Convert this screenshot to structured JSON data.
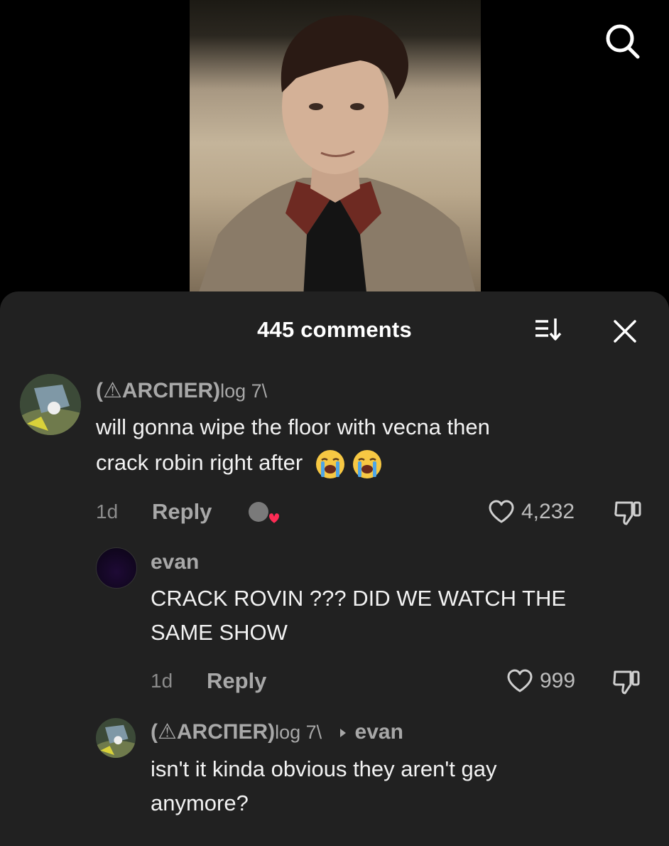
{
  "header": {
    "comment_count_title": "445 comments"
  },
  "comments": [
    {
      "username": "(⚠ARCПER)",
      "username_suffix": "log 7\\",
      "text_line1": "will gonna wipe the floor with vecna then",
      "text_line2": "crack robin right after",
      "emojis": [
        "loudly-crying-face",
        "loudly-crying-face"
      ],
      "time": "1d",
      "reply_label": "Reply",
      "likes": "4,232"
    },
    {
      "username": "evan",
      "text_line1": "CRACK ROVIN ??? DID WE WATCH THE",
      "text_line2": "SAME SHOW",
      "time": "1d",
      "reply_label": "Reply",
      "likes": "999"
    },
    {
      "username": "(⚠ARCПER)",
      "username_suffix": "log 7\\",
      "reply_to": "evan",
      "text_line1": "isn't it kinda obvious they aren't gay",
      "text_line2": "anymore?"
    }
  ],
  "colors": {
    "sheet_background": "#212121",
    "username": "#a8a8a8",
    "liked_heart": "#fe2c55"
  },
  "icons": {
    "top_right": "search-icon",
    "sort": "sort-icon",
    "close": "close-icon",
    "like": "heart-outline-icon",
    "dislike": "thumbs-down-icon",
    "creator_liked": "creator-liked-icon"
  }
}
